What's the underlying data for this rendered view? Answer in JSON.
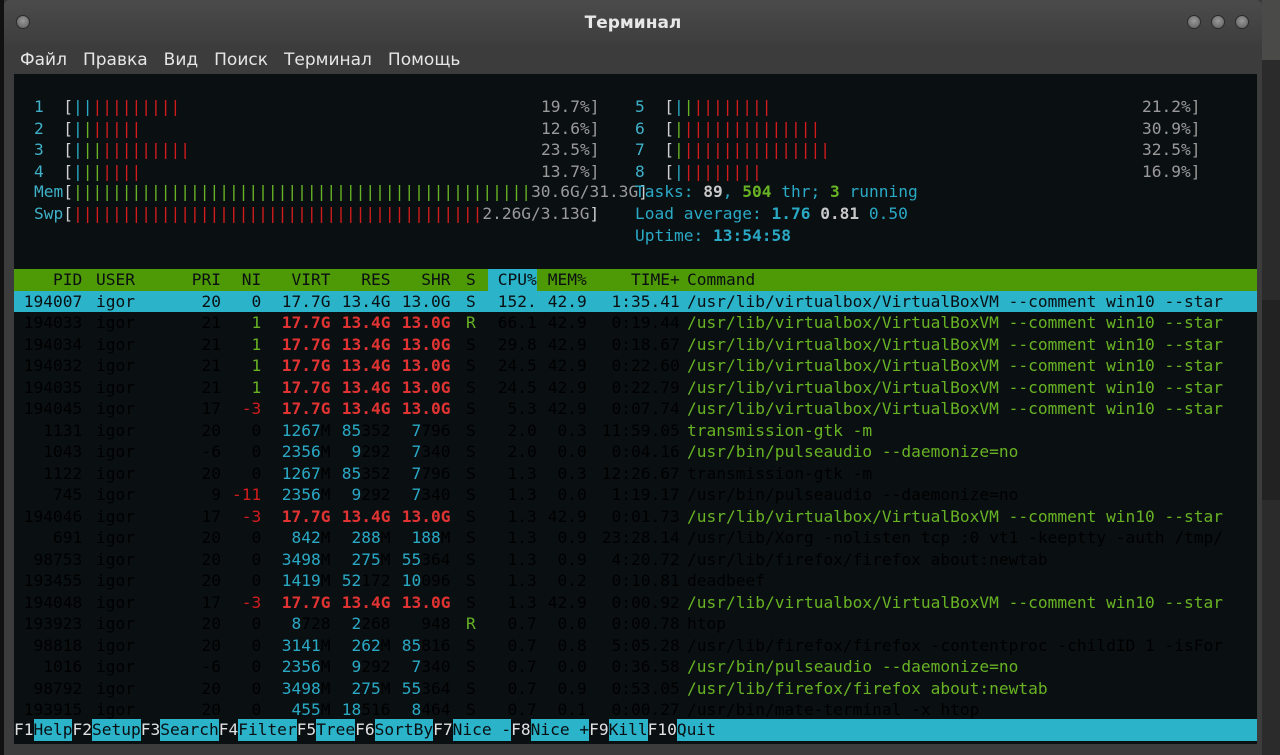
{
  "window": {
    "title": "Терминал"
  },
  "menubar": [
    "Файл",
    "Правка",
    "Вид",
    "Поиск",
    "Терминал",
    "Помощь"
  ],
  "cpus_left": [
    {
      "id": "1",
      "pct": "19.7%]",
      "blue": 2,
      "green": 0,
      "red": 9
    },
    {
      "id": "2",
      "pct": "12.6%]",
      "blue": 1,
      "green": 1,
      "red": 5
    },
    {
      "id": "3",
      "pct": "23.5%]",
      "blue": 1,
      "green": 2,
      "red": 9
    },
    {
      "id": "4",
      "pct": "13.7%]",
      "blue": 1,
      "green": 2,
      "red": 4
    }
  ],
  "cpus_right": [
    {
      "id": "5",
      "pct": "21.2%]",
      "blue": 1,
      "green": 1,
      "red": 8
    },
    {
      "id": "6",
      "pct": "30.9%]",
      "blue": 0,
      "green": 1,
      "red": 14
    },
    {
      "id": "7",
      "pct": "32.5%]",
      "blue": 0,
      "green": 1,
      "red": 15
    },
    {
      "id": "8",
      "pct": "16.9%]",
      "blue": 1,
      "green": 0,
      "red": 8
    }
  ],
  "mem": {
    "label": "Mem",
    "value": "30.6G/31.3G"
  },
  "swp": {
    "label": "Swp",
    "value": "2.26G/3.13G"
  },
  "tasks": {
    "prefix": "Tasks: ",
    "tasks": "89",
    "sep1": ", ",
    "threads": "504",
    "thr": " thr; ",
    "running": "3",
    "running_label": " running"
  },
  "load": {
    "prefix": "Load average: ",
    "l1": "1.76",
    "l5": "0.81",
    "l15": "0.50"
  },
  "uptime": {
    "prefix": "Uptime: ",
    "value": "13:54:58"
  },
  "columns": [
    "PID",
    "USER",
    "PRI",
    "NI",
    "VIRT",
    "RES",
    "SHR",
    "S",
    "CPU%",
    "MEM%",
    "TIME+",
    "Command"
  ],
  "processes": [
    {
      "pid": "194007",
      "user": "igor",
      "pri": "20",
      "ni": "0",
      "virt": "17.7G",
      "res": "13.4G",
      "shr": "13.0G",
      "s": "S",
      "cpu": "152.",
      "mem": "42.9",
      "time": "1:35.41",
      "cmd": "/usr/lib/virtualbox/VirtualBoxVM --comment win10 --star",
      "style": "sel"
    },
    {
      "pid": "194033",
      "user": "igor",
      "pri": "21",
      "ni": "1",
      "virt": "17.7G",
      "res": "13.4G",
      "shr": "13.0G",
      "s": "R",
      "cpu": "66.1",
      "mem": "42.9",
      "time": "0:19.44",
      "cmd": "/usr/lib/virtualbox/VirtualBoxVM --comment win10 --star",
      "style": "thread",
      "nicolor": "green"
    },
    {
      "pid": "194034",
      "user": "igor",
      "pri": "21",
      "ni": "1",
      "virt": "17.7G",
      "res": "13.4G",
      "shr": "13.0G",
      "s": "S",
      "cpu": "29.8",
      "mem": "42.9",
      "time": "0:18.67",
      "cmd": "/usr/lib/virtualbox/VirtualBoxVM --comment win10 --star",
      "style": "thread",
      "nicolor": "green"
    },
    {
      "pid": "194032",
      "user": "igor",
      "pri": "21",
      "ni": "1",
      "virt": "17.7G",
      "res": "13.4G",
      "shr": "13.0G",
      "s": "S",
      "cpu": "24.5",
      "mem": "42.9",
      "time": "0:22.60",
      "cmd": "/usr/lib/virtualbox/VirtualBoxVM --comment win10 --star",
      "style": "thread",
      "nicolor": "green"
    },
    {
      "pid": "194035",
      "user": "igor",
      "pri": "21",
      "ni": "1",
      "virt": "17.7G",
      "res": "13.4G",
      "shr": "13.0G",
      "s": "S",
      "cpu": "24.5",
      "mem": "42.9",
      "time": "0:22.79",
      "cmd": "/usr/lib/virtualbox/VirtualBoxVM --comment win10 --star",
      "style": "thread",
      "nicolor": "green"
    },
    {
      "pid": "194045",
      "user": "igor",
      "pri": "17",
      "ni": "-3",
      "virt": "17.7G",
      "res": "13.4G",
      "shr": "13.0G",
      "s": "S",
      "cpu": "5.3",
      "mem": "42.9",
      "time": "0:07.74",
      "cmd": "/usr/lib/virtualbox/VirtualBoxVM --comment win10 --star",
      "style": "thread",
      "nicolor": "red"
    },
    {
      "pid": "1131",
      "user": "igor",
      "pri": "20",
      "ni": "0",
      "virt": "1267M",
      "res": "85352",
      "shr": "7796",
      "s": "S",
      "cpu": "2.0",
      "mem": "0.3",
      "time": "11:59.05",
      "cmd": "transmission-gtk -m",
      "style": "threadplain"
    },
    {
      "pid": "1043",
      "user": "igor",
      "pri": "-6",
      "ni": "0",
      "virt": "2356M",
      "res": "9292",
      "shr": "7340",
      "s": "S",
      "cpu": "2.0",
      "mem": "0.0",
      "time": "0:04.16",
      "cmd": "/usr/bin/pulseaudio --daemonize=no",
      "style": "threadplain"
    },
    {
      "pid": "1122",
      "user": "igor",
      "pri": "20",
      "ni": "0",
      "virt": "1267M",
      "res": "85352",
      "shr": "7796",
      "s": "S",
      "cpu": "1.3",
      "mem": "0.3",
      "time": "12:26.67",
      "cmd": "transmission-gtk -m",
      "style": "plain"
    },
    {
      "pid": "745",
      "user": "igor",
      "pri": "9",
      "ni": "-11",
      "virt": "2356M",
      "res": "9292",
      "shr": "7340",
      "s": "S",
      "cpu": "1.3",
      "mem": "0.0",
      "time": "1:19.17",
      "cmd": "/usr/bin/pulseaudio --daemonize=no",
      "style": "plain",
      "nicolor": "red"
    },
    {
      "pid": "194046",
      "user": "igor",
      "pri": "17",
      "ni": "-3",
      "virt": "17.7G",
      "res": "13.4G",
      "shr": "13.0G",
      "s": "S",
      "cpu": "1.3",
      "mem": "42.9",
      "time": "0:01.73",
      "cmd": "/usr/lib/virtualbox/VirtualBoxVM --comment win10 --star",
      "style": "thread",
      "nicolor": "red"
    },
    {
      "pid": "691",
      "user": "igor",
      "pri": "20",
      "ni": "0",
      "virt": "842M",
      "res": "288M",
      "shr": "188M",
      "s": "S",
      "cpu": "1.3",
      "mem": "0.9",
      "time": "23:28.14",
      "cmd": "/usr/lib/Xorg -nolisten tcp :0 vt1 -keeptty -auth /tmp/",
      "style": "plain"
    },
    {
      "pid": "98753",
      "user": "igor",
      "pri": "20",
      "ni": "0",
      "virt": "3498M",
      "res": "275M",
      "shr": "55364",
      "s": "S",
      "cpu": "1.3",
      "mem": "0.9",
      "time": "4:20.72",
      "cmd": "/usr/lib/firefox/firefox about:newtab",
      "style": "plain"
    },
    {
      "pid": "193455",
      "user": "igor",
      "pri": "20",
      "ni": "0",
      "virt": "1419M",
      "res": "52172",
      "shr": "10096",
      "s": "S",
      "cpu": "1.3",
      "mem": "0.2",
      "time": "0:10.81",
      "cmd": "deadbeef",
      "style": "plain"
    },
    {
      "pid": "194048",
      "user": "igor",
      "pri": "17",
      "ni": "-3",
      "virt": "17.7G",
      "res": "13.4G",
      "shr": "13.0G",
      "s": "S",
      "cpu": "1.3",
      "mem": "42.9",
      "time": "0:00.92",
      "cmd": "/usr/lib/virtualbox/VirtualBoxVM --comment win10 --star",
      "style": "thread",
      "nicolor": "red"
    },
    {
      "pid": "193923",
      "user": "igor",
      "pri": "20",
      "ni": "0",
      "virt": "8728",
      "res": "2268",
      "shr": "948",
      "s": "R",
      "cpu": "0.7",
      "mem": "0.0",
      "time": "0:00.78",
      "cmd": "htop",
      "style": "plain"
    },
    {
      "pid": "98818",
      "user": "igor",
      "pri": "20",
      "ni": "0",
      "virt": "3141M",
      "res": "262M",
      "shr": "85816",
      "s": "S",
      "cpu": "0.7",
      "mem": "0.8",
      "time": "5:05.28",
      "cmd": "/usr/lib/firefox/firefox -contentproc -childID 1 -isFor",
      "style": "plain"
    },
    {
      "pid": "1016",
      "user": "igor",
      "pri": "-6",
      "ni": "0",
      "virt": "2356M",
      "res": "9292",
      "shr": "7340",
      "s": "S",
      "cpu": "0.7",
      "mem": "0.0",
      "time": "0:36.58",
      "cmd": "/usr/bin/pulseaudio --daemonize=no",
      "style": "threadplain"
    },
    {
      "pid": "98792",
      "user": "igor",
      "pri": "20",
      "ni": "0",
      "virt": "3498M",
      "res": "275M",
      "shr": "55364",
      "s": "S",
      "cpu": "0.7",
      "mem": "0.9",
      "time": "0:53.05",
      "cmd": "/usr/lib/firefox/firefox about:newtab",
      "style": "threadplain"
    },
    {
      "pid": "193915",
      "user": "igor",
      "pri": "20",
      "ni": "0",
      "virt": "455M",
      "res": "18516",
      "shr": "8464",
      "s": "S",
      "cpu": "0.7",
      "mem": "0.1",
      "time": "0:00.27",
      "cmd": "/usr/bin/mate-terminal -x htop",
      "style": "plain"
    }
  ],
  "fkeys": [
    {
      "key": "F1",
      "label": "Help  "
    },
    {
      "key": "F2",
      "label": "Setup "
    },
    {
      "key": "F3",
      "label": "Search"
    },
    {
      "key": "F4",
      "label": "Filter"
    },
    {
      "key": "F5",
      "label": "Tree  "
    },
    {
      "key": "F6",
      "label": "SortBy"
    },
    {
      "key": "F7",
      "label": "Nice -"
    },
    {
      "key": "F8",
      "label": "Nice +"
    },
    {
      "key": "F9",
      "label": "Kill  "
    },
    {
      "key": "F10",
      "label": "Quit"
    }
  ],
  "colors": {
    "cyan": "#2bb3c9",
    "green": "#4e9a06",
    "red": "#d21c1c",
    "bg": "#0a0f12"
  }
}
